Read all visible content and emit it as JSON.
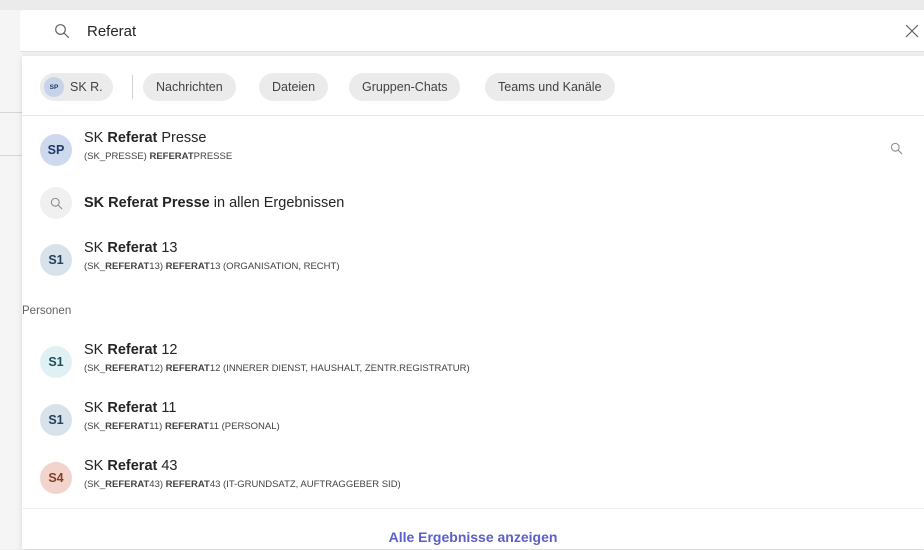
{
  "search": {
    "query": "Referat"
  },
  "filters": {
    "person_chip": {
      "initials": "SP",
      "label": "SK R."
    },
    "chips": [
      "Nachrichten",
      "Dateien",
      "Gruppen-Chats",
      "Teams und Kanäle"
    ]
  },
  "results": [
    {
      "initials": "SP",
      "l1": [
        "SK ",
        "Referat",
        " Presse"
      ],
      "l2": [
        "(SK_PRESSE) ",
        "REFERAT",
        "PRESSE"
      ]
    },
    {
      "initials": "S1",
      "l1": [
        "SK ",
        "Referat",
        " 13"
      ],
      "l2": [
        "(SK_",
        "REFERAT",
        "13) ",
        "REFERAT",
        "13 (ORGANISATION, RECHT)"
      ]
    }
  ],
  "all_results_row": {
    "bold": "SK Referat Presse",
    "rest": " in allen Ergebnissen"
  },
  "people_section": {
    "heading": "Personen",
    "items": [
      {
        "initials": "S1",
        "l1": [
          "SK ",
          "Referat",
          " 12"
        ],
        "l2": [
          "(SK_",
          "REFERAT",
          "12) ",
          "REFERAT",
          "12 (INNERER DIENST, HAUSHALT, ZENTR.REGISTRATUR)"
        ]
      },
      {
        "initials": "S1",
        "l1": [
          "SK ",
          "Referat",
          " 11"
        ],
        "l2": [
          "(SK_",
          "REFERAT",
          "11) ",
          "REFERAT",
          "11 (PERSONAL)"
        ]
      },
      {
        "initials": "S4",
        "l1": [
          "SK ",
          "Referat",
          " 43"
        ],
        "l2": [
          "(SK_",
          "REFERAT",
          "43) ",
          "REFERAT",
          "43 (IT-GRUNDSATZ, AUFTRAGGEBER SID)"
        ]
      }
    ]
  },
  "footer": {
    "link": "Alle Ergebnisse anzeigen"
  },
  "colors": {
    "accent": "#5b5fc7",
    "avatar_sp": "#cdd9ec",
    "avatar_s1_a": "#d7e2ea",
    "avatar_s1_b": "#dff1f3",
    "avatar_s4": "#f3d4cd"
  }
}
